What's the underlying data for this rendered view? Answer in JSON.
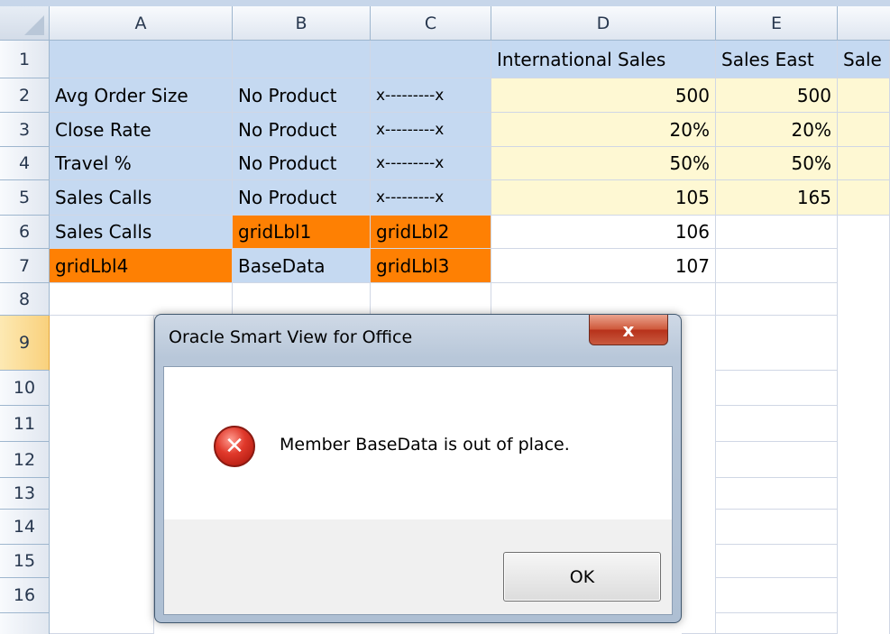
{
  "spreadsheet": {
    "columns": [
      "A",
      "B",
      "C",
      "D",
      "E"
    ],
    "rows": [
      "1",
      "2",
      "3",
      "4",
      "5",
      "6",
      "7",
      "8",
      "9",
      "10",
      "11",
      "12",
      "13",
      "14",
      "15",
      "16"
    ],
    "cells": {
      "A2": "Avg Order Size",
      "B2": "No Product",
      "C2": "x---------x",
      "D2": "500",
      "E2": "500",
      "A3": "Close Rate",
      "B3": "No Product",
      "C3": "x---------x",
      "D3": "20%",
      "E3": "20%",
      "A4": "Travel %",
      "B4": "No Product",
      "C4": "x---------x",
      "D4": "50%",
      "E4": "50%",
      "A5": "Sales Calls",
      "B5": "No Product",
      "C5": "x---------x",
      "D5": "105",
      "E5": "165",
      "A6": "Sales Calls",
      "B6": "gridLbl1",
      "C6": "gridLbl2",
      "D6": "106",
      "A7": "gridLbl4",
      "B7": "BaseData",
      "C7": "gridLbl3",
      "D7": "107",
      "D1": "International Sales",
      "E1": "Sales East",
      "F1": "Sale"
    },
    "selected_row": "9",
    "colors": {
      "member": "#c5d9f1",
      "data": "#fef8d3",
      "invalid": "#fe8003"
    }
  },
  "dialog": {
    "title": "Oracle Smart View for Office",
    "close_label": "x",
    "icon": "error-icon",
    "icon_glyph": "✕",
    "message": "Member BaseData is out of place.",
    "ok_label": "OK"
  }
}
